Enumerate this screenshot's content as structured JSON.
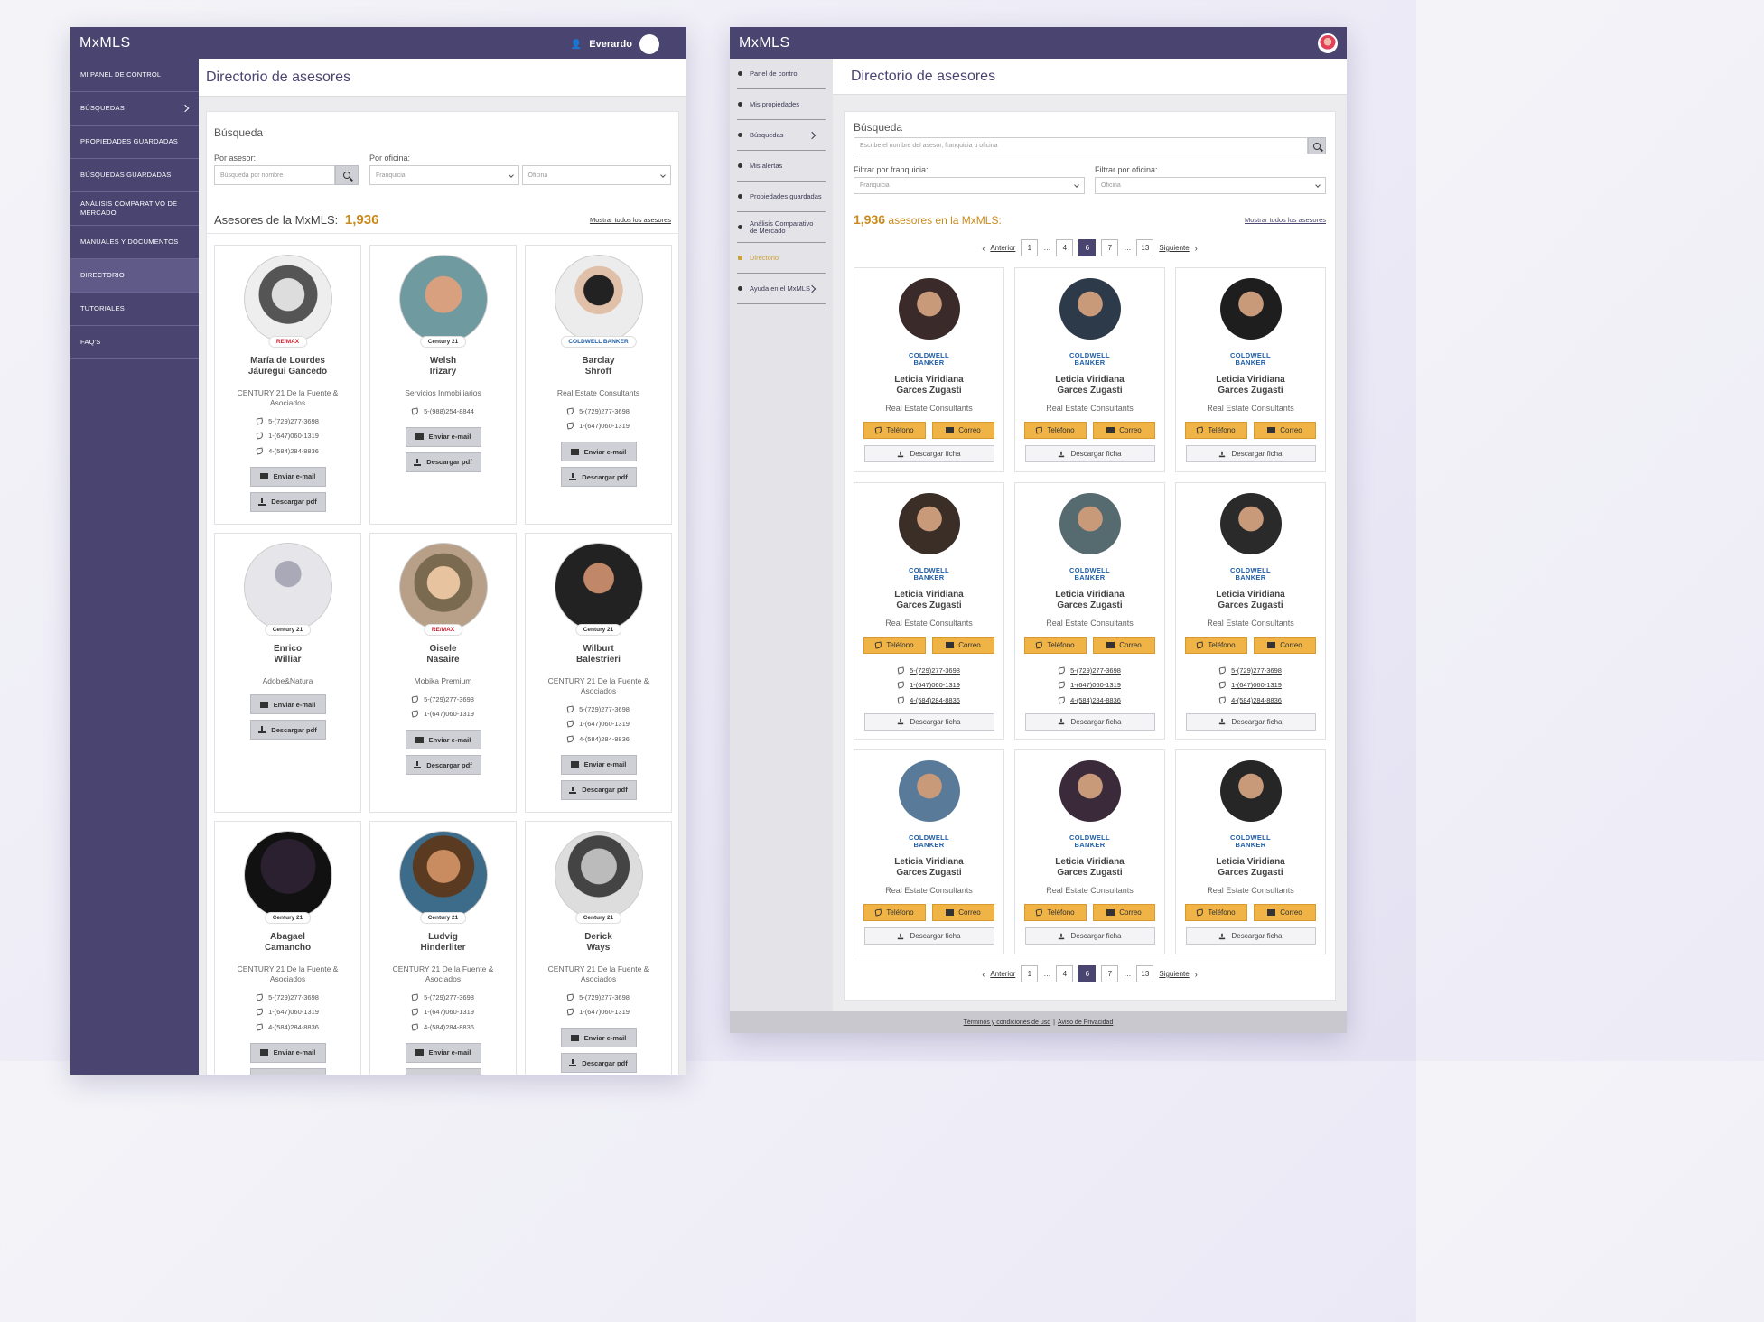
{
  "left": {
    "logo": "MxMLS",
    "user_name": "Everardo",
    "menu": [
      {
        "label": "MI PANEL DE CONTROL"
      },
      {
        "label": "BÚSQUEDAS"
      },
      {
        "label": "PROPIEDADES GUARDADAS"
      },
      {
        "label": "BÚSQUEDAS GUARDADAS"
      },
      {
        "label": "ANÁLISIS COMPARATIVO DE MERCADO"
      },
      {
        "label": "MANUALES Y DOCUMENTOS"
      },
      {
        "label": "DIRECTORIO"
      },
      {
        "label": "TUTORIALES"
      },
      {
        "label": "FAQ'S"
      }
    ],
    "page_title": "Directorio de asesores",
    "search_title": "Búsqueda",
    "by_agent_label": "Por asesor:",
    "by_agent_placeholder": "Búsqueda por nombre",
    "by_office_label": "Por oficina:",
    "franchise_value": "Franquicia",
    "office_value": "Oficina",
    "count_label": "Asesores de la MxMLS:",
    "count": "1,936",
    "show_all": "Mostrar todos los asesores",
    "email_btn": "Enviar e-mail",
    "pdf_btn": "Descargar pdf",
    "agents": [
      {
        "first": "María de Lourdes",
        "last": "Jáuregui Gancedo",
        "brand": "RE/MAX",
        "office": "CENTURY 21 De la Fuente & Asociados",
        "phones": [
          "5-(729)277-3698",
          "1-(647)060-1319",
          "4-(584)284-8836"
        ]
      },
      {
        "first": "Welsh",
        "last": "Irizary",
        "brand": "Century 21",
        "office": "Servicios Inmobiliarios",
        "phones": [
          "5-(988)254-8844"
        ]
      },
      {
        "first": "Barclay",
        "last": "Shroff",
        "brand": "COLDWELL BANKER",
        "office": "Real Estate Consultants",
        "phones": [
          "5-(729)277-3698",
          "1-(647)060-1319"
        ]
      },
      {
        "first": "Enrico",
        "last": "Williar",
        "brand": "Century 21",
        "office": "Adobe&Natura",
        "phones": []
      },
      {
        "first": "Gisele",
        "last": "Nasaire",
        "brand": "RE/MAX",
        "office": "Mobika Premium",
        "phones": [
          "5-(729)277-3698",
          "1-(647)060-1319"
        ]
      },
      {
        "first": "Wilburt",
        "last": "Balestrieri",
        "brand": "Century 21",
        "office": "CENTURY 21 De la Fuente & Asociados",
        "phones": [
          "5-(729)277-3698",
          "1-(647)060-1319",
          "4-(584)284-8836"
        ]
      },
      {
        "first": "Abagael",
        "last": "Camancho",
        "brand": "Century 21",
        "office": "CENTURY 21 De la Fuente & Asociados",
        "phones": [
          "5-(729)277-3698",
          "1-(647)060-1319",
          "4-(584)284-8836"
        ]
      },
      {
        "first": "Ludvig",
        "last": "Hinderliter",
        "brand": "Century 21",
        "office": "CENTURY 21 De la Fuente & Asociados",
        "phones": [
          "5-(729)277-3698",
          "1-(647)060-1319",
          "4-(584)284-8836"
        ]
      },
      {
        "first": "Derick",
        "last": "Ways",
        "brand": "Century 21",
        "office": "CENTURY 21 De la Fuente & Asociados",
        "phones": [
          "5-(729)277-3698",
          "1-(647)060-1319"
        ]
      }
    ]
  },
  "right": {
    "logo": "MxMLS",
    "menu": [
      {
        "label": "Panel de control",
        "chev": false
      },
      {
        "label": "Mis propiedades",
        "chev": false
      },
      {
        "label": "Búsquedas",
        "chev": true
      },
      {
        "label": "Mis alertas",
        "chev": false
      },
      {
        "label": "Propiedades guardadas",
        "chev": false
      },
      {
        "label": "Análisis Comparativo de Mercado",
        "chev": false
      },
      {
        "label": "Directorio",
        "chev": false
      },
      {
        "label": "Ayuda en el MxMLS",
        "chev": true
      }
    ],
    "page_title": "Directorio de asesores",
    "search_title": "Búsqueda",
    "search_placeholder": "Escribe el nombre del asesor, franquicia u oficina",
    "franchise_label": "Filtrar por franquicia:",
    "franchise_value": "Franquicia",
    "office_label": "Filtrar por oficina:",
    "office_value": "Oficina",
    "count": "1,936",
    "count_label": "asesores en la MxMLS:",
    "show_all": "Mostrar todos los asesores",
    "pagination": {
      "prev": "Anterior",
      "next": "Siguiente",
      "pages": [
        "1",
        "…",
        "4",
        "6",
        "7",
        "…",
        "13"
      ],
      "current": "6"
    },
    "brand": "COLDWELL BANKER",
    "phone_btn": "Teléfono",
    "mail_btn": "Correo",
    "sheet_btn": "Descargar ficha",
    "agent_first": "Leticia Viridiana",
    "agent_last": "Garces Zugasti",
    "agent_office": "Real Estate Consultants",
    "phones": [
      "5-(729)277-3698",
      "1-(647)060-1319",
      "4-(584)284-8836"
    ],
    "footer_terms": "Términos y condiciones de uso",
    "footer_sep": "|",
    "footer_privacy": "Aviso de Privacidad"
  },
  "colors": {
    "primary": "#4a4570",
    "accent": "#f0b345",
    "count": "#c98a1d",
    "coldwell": "#1f5ea8"
  }
}
